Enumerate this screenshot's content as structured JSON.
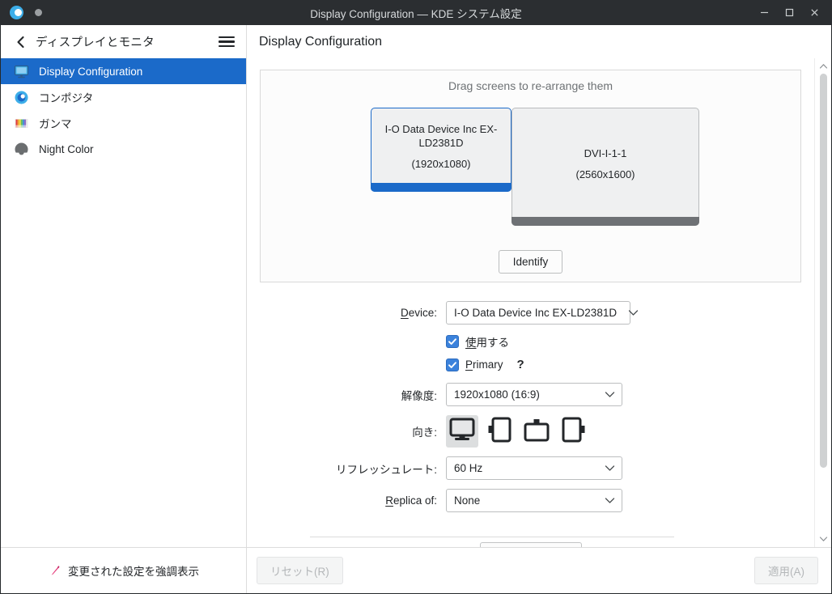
{
  "titlebar": {
    "title": "Display Configuration — KDE システム設定",
    "minimize_label": "minimize",
    "maximize_label": "maximize",
    "close_label": "close"
  },
  "sidebar": {
    "header_title": "ディスプレイとモニタ",
    "back_label": "back",
    "menu_label": "menu",
    "items": [
      {
        "label": "Display Configuration",
        "icon": "monitor-icon",
        "selected": true
      },
      {
        "label": "コンポジタ",
        "icon": "compositor-icon",
        "selected": false
      },
      {
        "label": "ガンマ",
        "icon": "gamma-icon",
        "selected": false
      },
      {
        "label": "Night Color",
        "icon": "night-color-icon",
        "selected": false
      }
    ]
  },
  "content": {
    "header_title": "Display Configuration",
    "drag_hint": "Drag screens to re-arrange them",
    "screens": [
      {
        "name": "I-O Data Device Inc EX-LD2381D",
        "resolution": "(1920x1080)",
        "selected": true
      },
      {
        "name": "DVI-I-1-1",
        "resolution": "(2560x1600)",
        "selected": false
      }
    ],
    "identify_button": "Identify",
    "form": {
      "device_label": "Device:",
      "device_label_mnemonic": "D",
      "device_label_rest": "evice:",
      "device_value": "I-O Data Device Inc EX-LD2381D",
      "enabled_checkbox_mnemonic": "使",
      "enabled_checkbox_rest": "用する",
      "enabled_checked": true,
      "primary_checkbox_mnemonic": "P",
      "primary_checkbox_rest": "rimary",
      "primary_checked": true,
      "help_glyph": "?",
      "resolution_label": "解像度:",
      "resolution_value": "1920x1080 (16:9)",
      "orientation_label": "向き:",
      "orientation_options": [
        {
          "name": "landscape",
          "selected": true
        },
        {
          "name": "portrait-right",
          "selected": false
        },
        {
          "name": "landscape-flipped",
          "selected": false
        },
        {
          "name": "portrait-left",
          "selected": false
        }
      ],
      "refresh_label": "リフレッシュレート:",
      "refresh_value": "60 Hz",
      "replica_label_mnemonic": "R",
      "replica_label_rest": "eplica of:",
      "replica_value": "None"
    }
  },
  "footer": {
    "highlight_label": "変更された設定を強調表示",
    "reset_label": "リセット(R)",
    "apply_label": "適用(A)"
  },
  "colors": {
    "accent": "#1b6ac9",
    "titlebar_bg": "#2b2e31",
    "selected_text": "#ffffff",
    "checkbox_blue": "#3b82dc",
    "pencil_pink": "#e6407e"
  }
}
